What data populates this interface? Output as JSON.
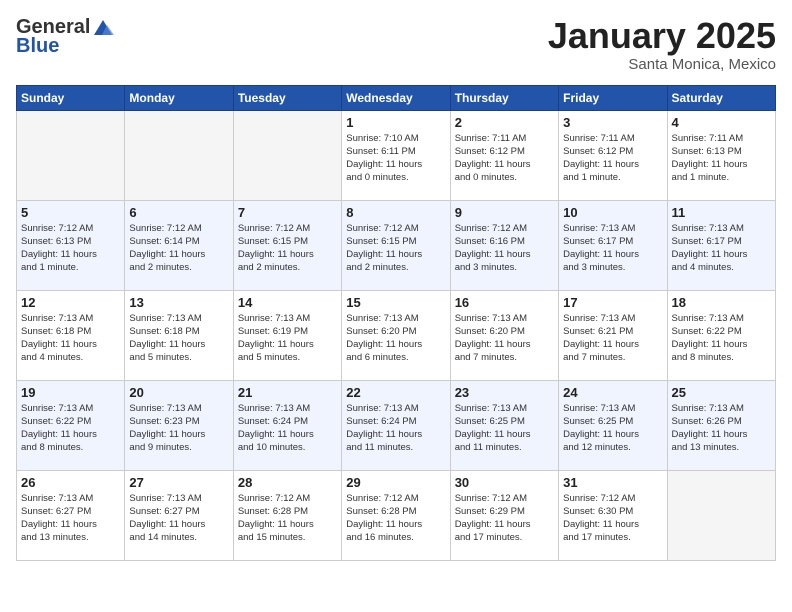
{
  "header": {
    "logo_general": "General",
    "logo_blue": "Blue",
    "month": "January 2025",
    "location": "Santa Monica, Mexico"
  },
  "weekdays": [
    "Sunday",
    "Monday",
    "Tuesday",
    "Wednesday",
    "Thursday",
    "Friday",
    "Saturday"
  ],
  "weeks": [
    [
      {
        "day": "",
        "info": ""
      },
      {
        "day": "",
        "info": ""
      },
      {
        "day": "",
        "info": ""
      },
      {
        "day": "1",
        "info": "Sunrise: 7:10 AM\nSunset: 6:11 PM\nDaylight: 11 hours\nand 0 minutes."
      },
      {
        "day": "2",
        "info": "Sunrise: 7:11 AM\nSunset: 6:12 PM\nDaylight: 11 hours\nand 0 minutes."
      },
      {
        "day": "3",
        "info": "Sunrise: 7:11 AM\nSunset: 6:12 PM\nDaylight: 11 hours\nand 1 minute."
      },
      {
        "day": "4",
        "info": "Sunrise: 7:11 AM\nSunset: 6:13 PM\nDaylight: 11 hours\nand 1 minute."
      }
    ],
    [
      {
        "day": "5",
        "info": "Sunrise: 7:12 AM\nSunset: 6:13 PM\nDaylight: 11 hours\nand 1 minute."
      },
      {
        "day": "6",
        "info": "Sunrise: 7:12 AM\nSunset: 6:14 PM\nDaylight: 11 hours\nand 2 minutes."
      },
      {
        "day": "7",
        "info": "Sunrise: 7:12 AM\nSunset: 6:15 PM\nDaylight: 11 hours\nand 2 minutes."
      },
      {
        "day": "8",
        "info": "Sunrise: 7:12 AM\nSunset: 6:15 PM\nDaylight: 11 hours\nand 2 minutes."
      },
      {
        "day": "9",
        "info": "Sunrise: 7:12 AM\nSunset: 6:16 PM\nDaylight: 11 hours\nand 3 minutes."
      },
      {
        "day": "10",
        "info": "Sunrise: 7:13 AM\nSunset: 6:17 PM\nDaylight: 11 hours\nand 3 minutes."
      },
      {
        "day": "11",
        "info": "Sunrise: 7:13 AM\nSunset: 6:17 PM\nDaylight: 11 hours\nand 4 minutes."
      }
    ],
    [
      {
        "day": "12",
        "info": "Sunrise: 7:13 AM\nSunset: 6:18 PM\nDaylight: 11 hours\nand 4 minutes."
      },
      {
        "day": "13",
        "info": "Sunrise: 7:13 AM\nSunset: 6:18 PM\nDaylight: 11 hours\nand 5 minutes."
      },
      {
        "day": "14",
        "info": "Sunrise: 7:13 AM\nSunset: 6:19 PM\nDaylight: 11 hours\nand 5 minutes."
      },
      {
        "day": "15",
        "info": "Sunrise: 7:13 AM\nSunset: 6:20 PM\nDaylight: 11 hours\nand 6 minutes."
      },
      {
        "day": "16",
        "info": "Sunrise: 7:13 AM\nSunset: 6:20 PM\nDaylight: 11 hours\nand 7 minutes."
      },
      {
        "day": "17",
        "info": "Sunrise: 7:13 AM\nSunset: 6:21 PM\nDaylight: 11 hours\nand 7 minutes."
      },
      {
        "day": "18",
        "info": "Sunrise: 7:13 AM\nSunset: 6:22 PM\nDaylight: 11 hours\nand 8 minutes."
      }
    ],
    [
      {
        "day": "19",
        "info": "Sunrise: 7:13 AM\nSunset: 6:22 PM\nDaylight: 11 hours\nand 8 minutes."
      },
      {
        "day": "20",
        "info": "Sunrise: 7:13 AM\nSunset: 6:23 PM\nDaylight: 11 hours\nand 9 minutes."
      },
      {
        "day": "21",
        "info": "Sunrise: 7:13 AM\nSunset: 6:24 PM\nDaylight: 11 hours\nand 10 minutes."
      },
      {
        "day": "22",
        "info": "Sunrise: 7:13 AM\nSunset: 6:24 PM\nDaylight: 11 hours\nand 11 minutes."
      },
      {
        "day": "23",
        "info": "Sunrise: 7:13 AM\nSunset: 6:25 PM\nDaylight: 11 hours\nand 11 minutes."
      },
      {
        "day": "24",
        "info": "Sunrise: 7:13 AM\nSunset: 6:25 PM\nDaylight: 11 hours\nand 12 minutes."
      },
      {
        "day": "25",
        "info": "Sunrise: 7:13 AM\nSunset: 6:26 PM\nDaylight: 11 hours\nand 13 minutes."
      }
    ],
    [
      {
        "day": "26",
        "info": "Sunrise: 7:13 AM\nSunset: 6:27 PM\nDaylight: 11 hours\nand 13 minutes."
      },
      {
        "day": "27",
        "info": "Sunrise: 7:13 AM\nSunset: 6:27 PM\nDaylight: 11 hours\nand 14 minutes."
      },
      {
        "day": "28",
        "info": "Sunrise: 7:12 AM\nSunset: 6:28 PM\nDaylight: 11 hours\nand 15 minutes."
      },
      {
        "day": "29",
        "info": "Sunrise: 7:12 AM\nSunset: 6:28 PM\nDaylight: 11 hours\nand 16 minutes."
      },
      {
        "day": "30",
        "info": "Sunrise: 7:12 AM\nSunset: 6:29 PM\nDaylight: 11 hours\nand 17 minutes."
      },
      {
        "day": "31",
        "info": "Sunrise: 7:12 AM\nSunset: 6:30 PM\nDaylight: 11 hours\nand 17 minutes."
      },
      {
        "day": "",
        "info": ""
      }
    ]
  ]
}
